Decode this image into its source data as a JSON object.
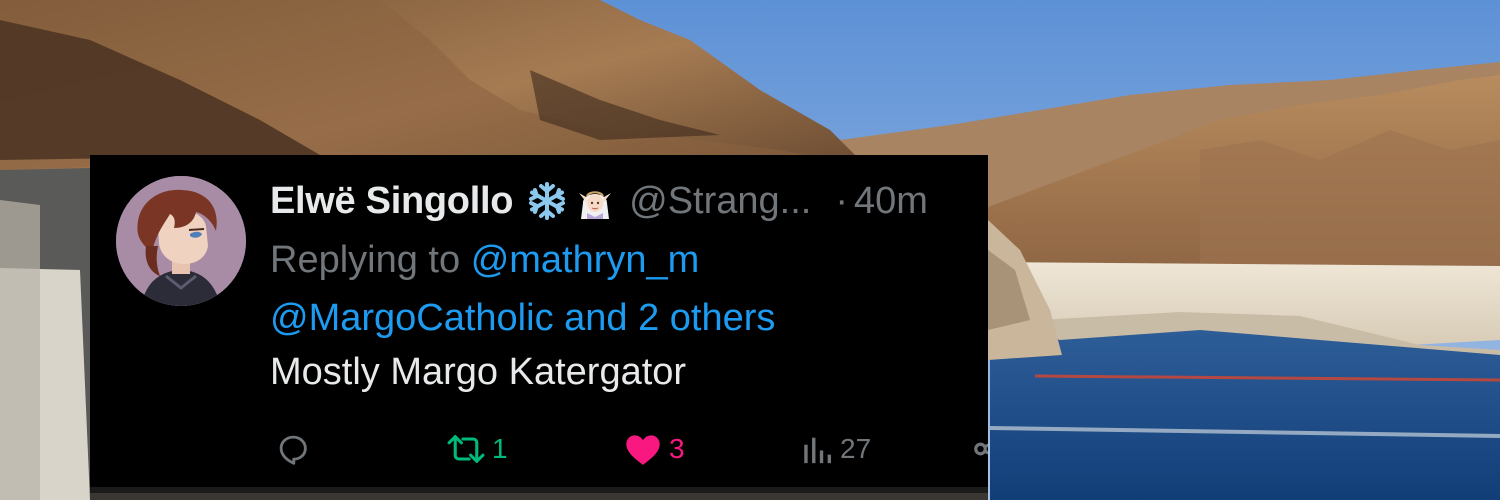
{
  "tweet": {
    "display_name": "Elwë Singollo",
    "handle": "@Strang...",
    "separator": "·",
    "time": "40m",
    "emoji_icons": [
      "snowflake-icon",
      "elf-icon"
    ],
    "reply_context": {
      "prefix": "Replying to",
      "mention_primary": "@mathryn_m",
      "mention_rest": "@MargoCatholic and 2 others"
    },
    "text": "Mostly Margo Katergator",
    "actions": {
      "replies": "",
      "retweets": "1",
      "likes": "3",
      "views": "27"
    }
  },
  "colors": {
    "card_background": "#000000",
    "name": "#e7e9ea",
    "secondary_text": "#71767b",
    "link": "#1d9bf0",
    "retweet": "#00ba7c",
    "like": "#f91880"
  },
  "background_image": "lake canyon photo"
}
